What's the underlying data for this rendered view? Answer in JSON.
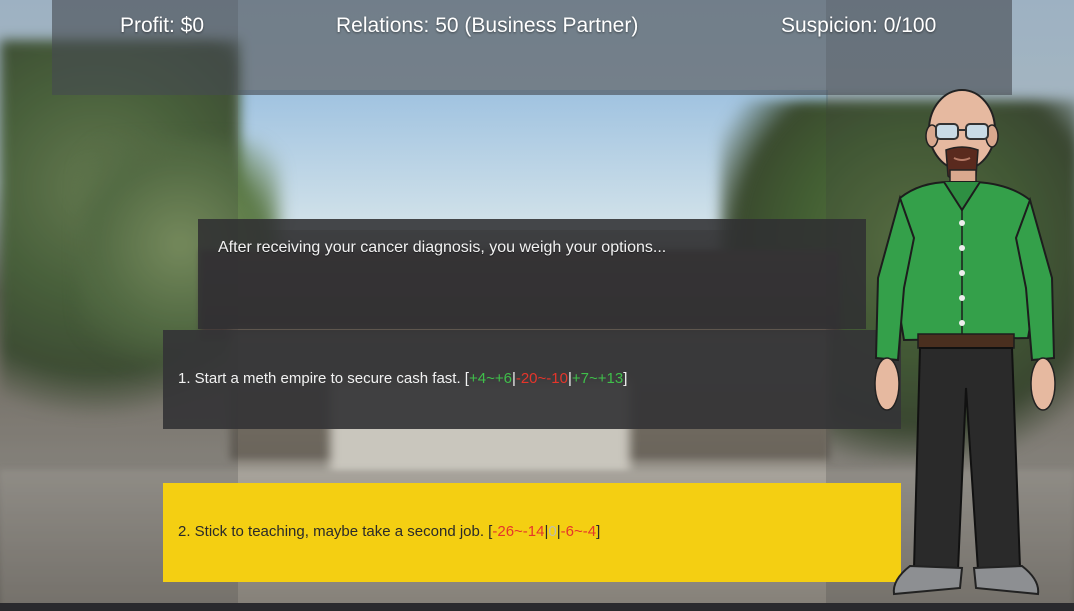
{
  "hud": {
    "profit": "Profit: $0",
    "relations": "Relations: 50 (Business Partner)",
    "suspicion": "Suspicion: 0/100"
  },
  "narration": "After receiving your cancer diagnosis, you weigh your options...",
  "choices": [
    {
      "prefix": "1. Start a meth empire to secure cash fast. [",
      "effects": [
        {
          "text": "+4~+6",
          "color": "#3fbf4a"
        },
        {
          "text": "-20~-10",
          "color": "#e5352b"
        },
        {
          "text": "+7~+13",
          "color": "#3fbf4a"
        }
      ],
      "separator": "|",
      "suffix": "]",
      "state": "default"
    },
    {
      "prefix": "2. Stick to teaching, maybe take a second job. [",
      "effects": [
        {
          "text": "-26~-14",
          "color": "#e5352b"
        },
        {
          "text": "0",
          "color": "#bdbdb0"
        },
        {
          "text": "-6~-4",
          "color": "#e5352b"
        }
      ],
      "separator": "|",
      "suffix": "]",
      "state": "highlighted"
    }
  ],
  "colors": {
    "positive": "#3fbf4a",
    "negative": "#e5352b",
    "highlight": "#f4cf12",
    "panel": "#343436"
  },
  "character": {
    "icon": "character-portrait-icon"
  }
}
